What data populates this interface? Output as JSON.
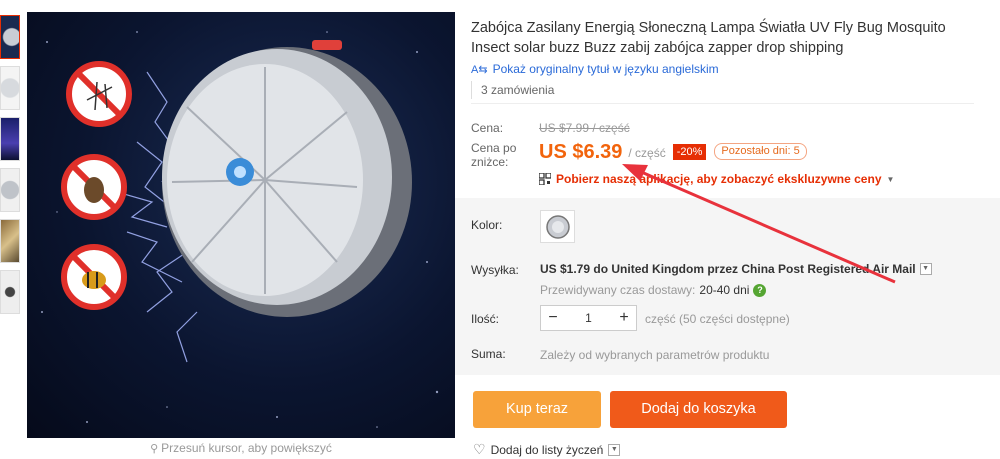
{
  "gallery": {
    "thumbnails": [
      "thumb-1",
      "thumb-2",
      "thumb-3",
      "thumb-4",
      "thumb-5",
      "thumb-6"
    ],
    "zoom_hint": "Przesuń kursor, aby powiększyć"
  },
  "product": {
    "title": "Zabójca Zasilany Energią Słoneczną Lampa Światła UV Fly Bug Mosquito Insect solar buzz Buzz zabij zabójca zapper drop shipping",
    "translate_link": "Pokaż oryginalny tytuł w języku angielskim",
    "orders": "3 zamówienia"
  },
  "price": {
    "old_label": "Cena:",
    "old_value": "US $7.99 / część",
    "now_label": "Cena po zniżce:",
    "now_value": "US $6.39",
    "per_unit": "/ część",
    "discount": "-20%",
    "days_left": "Pozostało dni: 5",
    "app_promo": "Pobierz naszą aplikację, aby zobaczyć ekskluzywne ceny"
  },
  "options": {
    "color_label": "Kolor:",
    "shipping_label": "Wysyłka:",
    "shipping_text": "US $1.79 do United Kingdom przez China Post Registered Air Mail",
    "delivery_label": "Przewidywany czas dostawy:",
    "delivery_days": "20-40 dni",
    "qty_label": "Ilość:",
    "qty_value": "1",
    "qty_note": "część (50 części dostępne)",
    "sum_label": "Suma:",
    "sum_value": "Zależy od wybranych parametrów produktu"
  },
  "actions": {
    "buy_now": "Kup teraz",
    "add_to_cart": "Dodaj do koszyka",
    "wishlist": "Dodaj do listy życzeń"
  },
  "colors": {
    "accent_orange": "#f2640c",
    "buy_button": "#f7a23a",
    "cart_button": "#f05a1a",
    "discount_red": "#e62e04",
    "link_blue": "#2a6ad8",
    "annotation_arrow": "#e8323c"
  }
}
